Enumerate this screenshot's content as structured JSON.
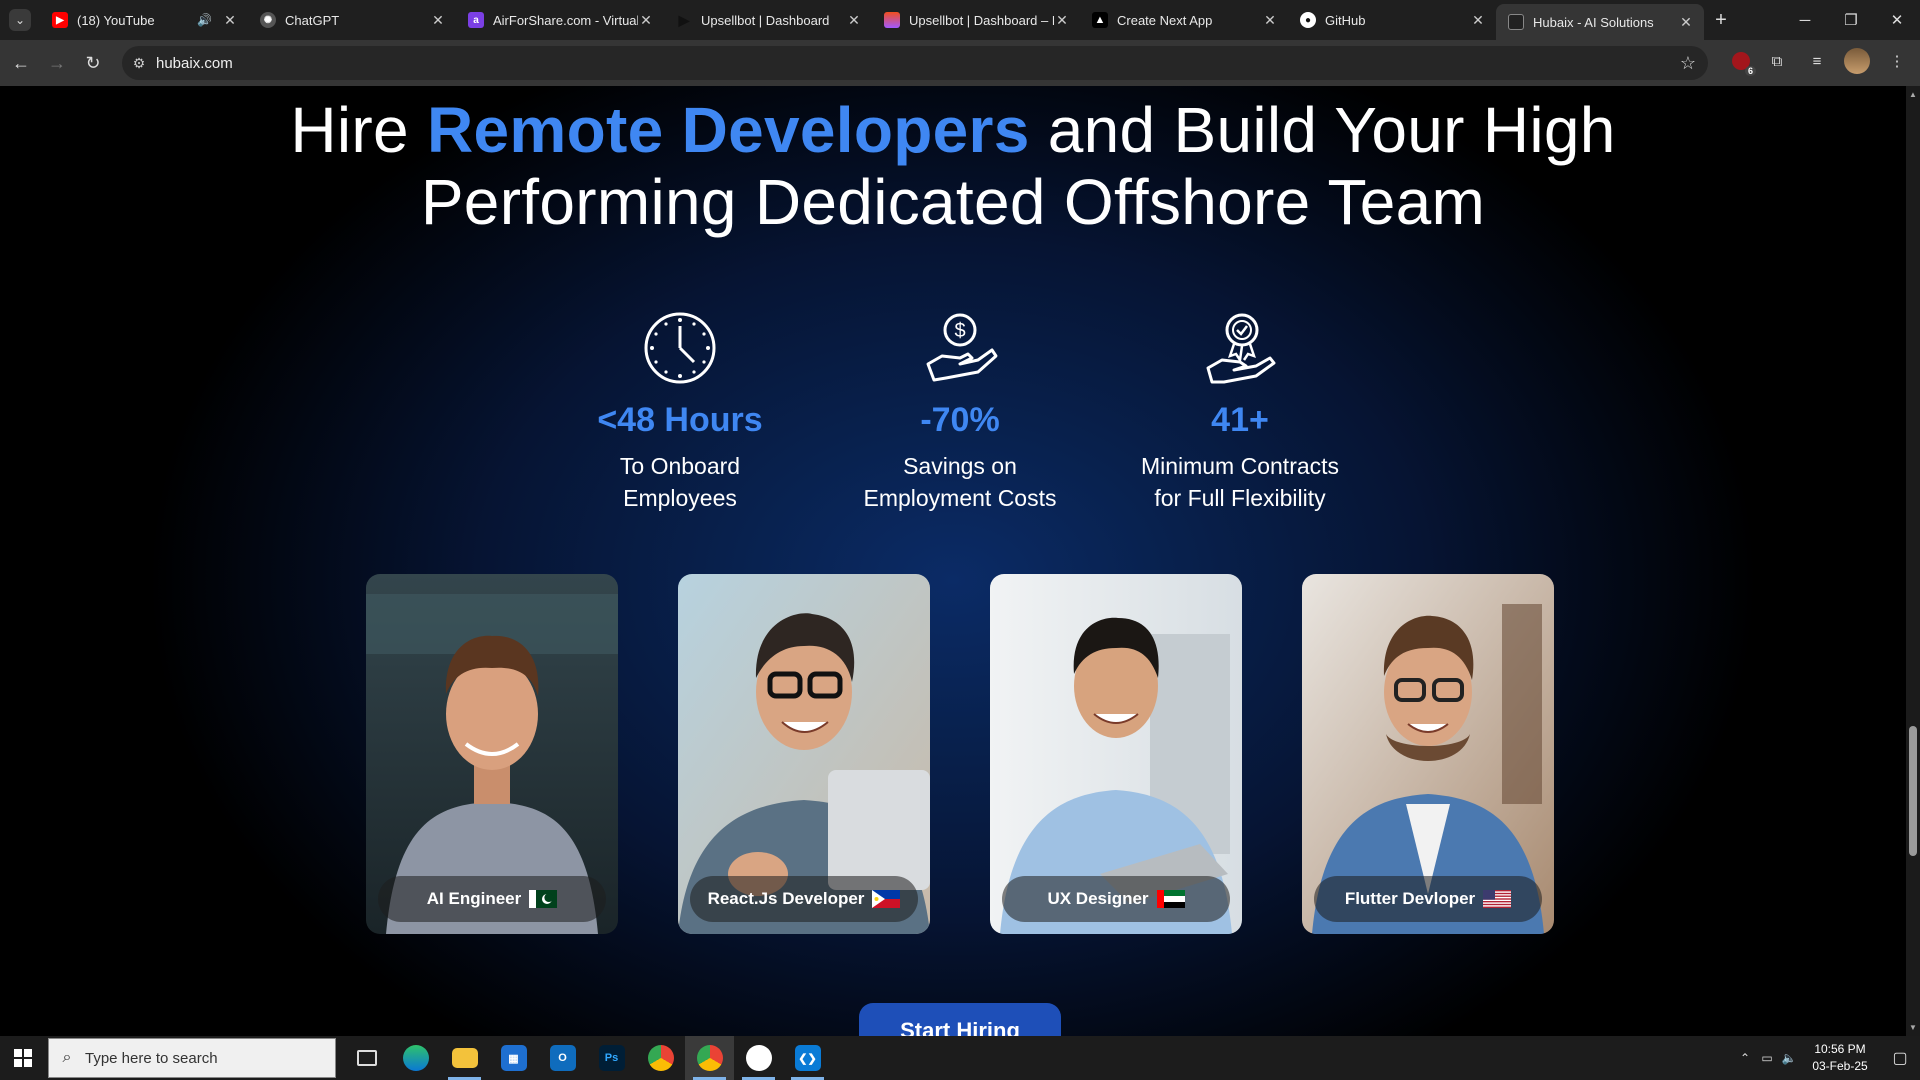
{
  "browser": {
    "tabs": [
      {
        "label": "(18) YouTube",
        "icon": "youtube-icon",
        "color": "#ff0000",
        "audio": true
      },
      {
        "label": "ChatGPT",
        "icon": "chatgpt-icon",
        "color": "#444444"
      },
      {
        "label": "AirForShare.com - Virtual",
        "icon": "airforshare-icon",
        "color": "#7b3fe4"
      },
      {
        "label": "Upsellbot | Dashboard",
        "icon": "play-icon",
        "color": "#111111"
      },
      {
        "label": "Upsellbot | Dashboard – F",
        "icon": "figma-icon",
        "color": "#f24e1e"
      },
      {
        "label": "Create Next App",
        "icon": "vercel-icon",
        "color": "#000000"
      },
      {
        "label": "GitHub",
        "icon": "github-icon",
        "color": "#ffffff"
      },
      {
        "label": "Hubaix - AI Solutions",
        "icon": "hubaix-icon",
        "color": "#222222",
        "active": true
      }
    ],
    "url": "hubaix.com",
    "extension_badge": "6"
  },
  "hero": {
    "title_part1": "Hire ",
    "title_highlight": "Remote Developers",
    "title_part2": " and Build Your High",
    "title_line2": "Performing Dedicated Offshore Team"
  },
  "stats": [
    {
      "icon": "clock-icon",
      "value": "<48 Hours",
      "label_line1": "To Onboard",
      "label_line2": "Employees"
    },
    {
      "icon": "money-hand-icon",
      "value": "-70%",
      "label_line1": "Savings on",
      "label_line2": "Employment Costs"
    },
    {
      "icon": "award-hand-icon",
      "value": "41+",
      "label_line1": "Minimum Contracts",
      "label_line2": "for Full Flexibility"
    }
  ],
  "developers": [
    {
      "role": "AI Engineer",
      "flag": "pakistan-flag"
    },
    {
      "role": "React.Js Developer",
      "flag": "philippines-flag"
    },
    {
      "role": "UX Designer",
      "flag": "uae-flag"
    },
    {
      "role": "Flutter Devloper",
      "flag": "usa-flag"
    }
  ],
  "cta_label": "Start Hiring",
  "taskbar": {
    "search_placeholder": "Type here to search",
    "time": "10:56 PM",
    "date": "03-Feb-25"
  },
  "colors": {
    "accent": "#3f87f2",
    "cta": "#1e4fb8",
    "page_bg": "#061433"
  }
}
